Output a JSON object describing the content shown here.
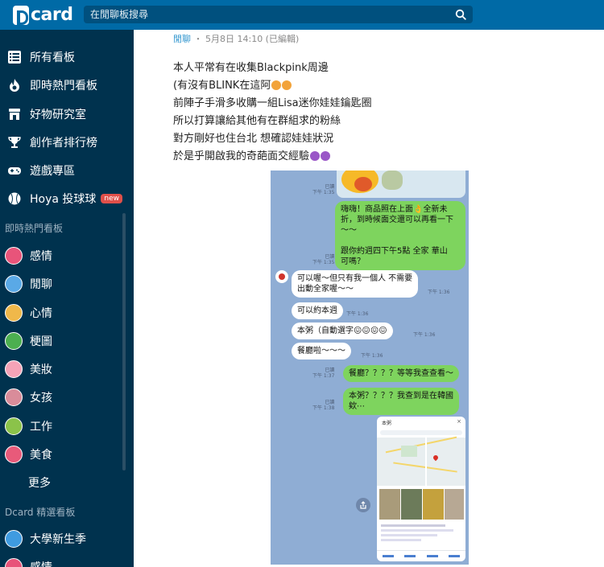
{
  "app": {
    "logo_text": "card",
    "search_placeholder": "在閒聊板搜尋"
  },
  "sidebar": {
    "main_items": [
      {
        "label": "所有看板",
        "icon": "list-icon"
      },
      {
        "label": "即時熱門看板",
        "icon": "flame-icon"
      },
      {
        "label": "好物研究室",
        "icon": "store-icon"
      },
      {
        "label": "創作者排行榜",
        "icon": "trophy-icon"
      },
      {
        "label": "遊戲專區",
        "icon": "gamepad-icon"
      },
      {
        "label": "Hoya 投球球",
        "icon": "baseball-icon",
        "badge": "new"
      }
    ],
    "hot_section_title": "即時熱門看板",
    "hot_boards": [
      {
        "label": "感情",
        "color": "#e8547a"
      },
      {
        "label": "閒聊",
        "color": "#5aa9e6"
      },
      {
        "label": "心情",
        "color": "#f0b84a"
      },
      {
        "label": "梗圖",
        "color": "#4caf50"
      },
      {
        "label": "美妝",
        "color": "#f5a3b7"
      },
      {
        "label": "女孩",
        "color": "#d98c9a"
      },
      {
        "label": "工作",
        "color": "#8bc34a"
      },
      {
        "label": "美食",
        "color": "#e85a7a"
      }
    ],
    "more_label": "更多",
    "featured_section_title": "Dcard 精選看板",
    "featured_boards": [
      {
        "label": "大學新生季",
        "color": "#3f9be0"
      },
      {
        "label": "感情",
        "color": "#e8547a"
      }
    ]
  },
  "post": {
    "board": "閒聊",
    "date": "・ 5月8日 14:10 (已編輯)",
    "lines": [
      "本人平常有在收集Blackpink周邊",
      "(有沒有BLINK在這阿",
      "前陣子手滑多收購一組Lisa迷你娃娃鑰匙圈",
      "所以打算讓給其他有在群組求的粉絲",
      "對方剛好也住台北 想確認娃娃狀況",
      "於是乎開啟我的奇葩面交經驗"
    ]
  },
  "chat": {
    "messages": [
      {
        "side": "right",
        "text": "嗨嗨！商品照在上面👌全新未\n折，到時候面交還可以再看一下\n～～\n\n跟你約週四下午5點 全家 華山\n可嗎？",
        "read": "已讀",
        "time": "下午 1:35"
      },
      {
        "side": "left",
        "text": "可以喔～但只有我一個人 不需要\n出動全家喔～～",
        "time": "下午 1:36"
      },
      {
        "side": "left",
        "text": "可以約本週",
        "time": "下午 1:36"
      },
      {
        "side": "left",
        "text": "本粥（自動選字😖😖😖😖",
        "time": "下午 1:36"
      },
      {
        "side": "left",
        "text": "餐廳啦～～～",
        "time": "下午 1:36"
      },
      {
        "side": "right",
        "text": "餐廳？？？？等等我查查看～",
        "read": "已讀",
        "time": "下午 1:37"
      },
      {
        "side": "right",
        "text": "本粥？？？？我查到是在韓國\n欸⋯",
        "read": "已讀",
        "time": "下午 1:38"
      }
    ],
    "top_read": "已讀",
    "top_time": "下午 1:35",
    "map_card_title": "本粥"
  }
}
